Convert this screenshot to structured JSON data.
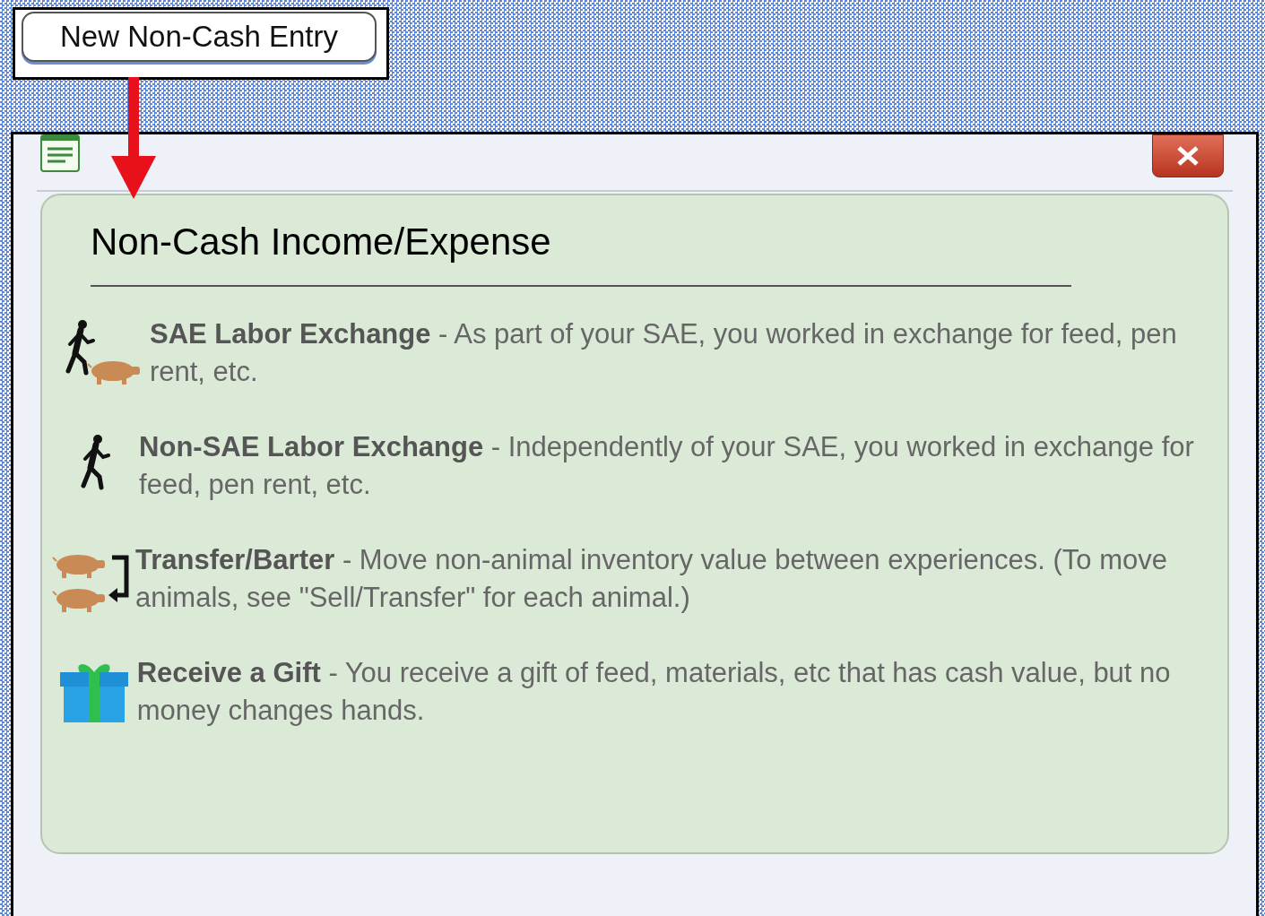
{
  "top_button": {
    "label": "New Non-Cash Entry"
  },
  "dialog": {
    "title": "Non-Cash Income/Expense",
    "options": [
      {
        "kind": "worker-pig",
        "text": "**SAE Labor Exchange** - As part of your SAE, you worked in exchange for feed, pen rent, etc."
      },
      {
        "kind": "worker",
        "text": "**Non-SAE Labor Exchange** - Independently of your SAE, you worked in exchange for feed, pen rent, etc."
      },
      {
        "kind": "pig-transfer",
        "text": "**Transfer/Barter** - Move non-animal inventory value between experiences. (To move animals, see \"Sell/Transfer\" for each animal.)"
      },
      {
        "kind": "gift",
        "text": "**Receive a Gift** - You receive a gift of feed, materials, etc that has cash value, but no money changes hands."
      }
    ]
  }
}
